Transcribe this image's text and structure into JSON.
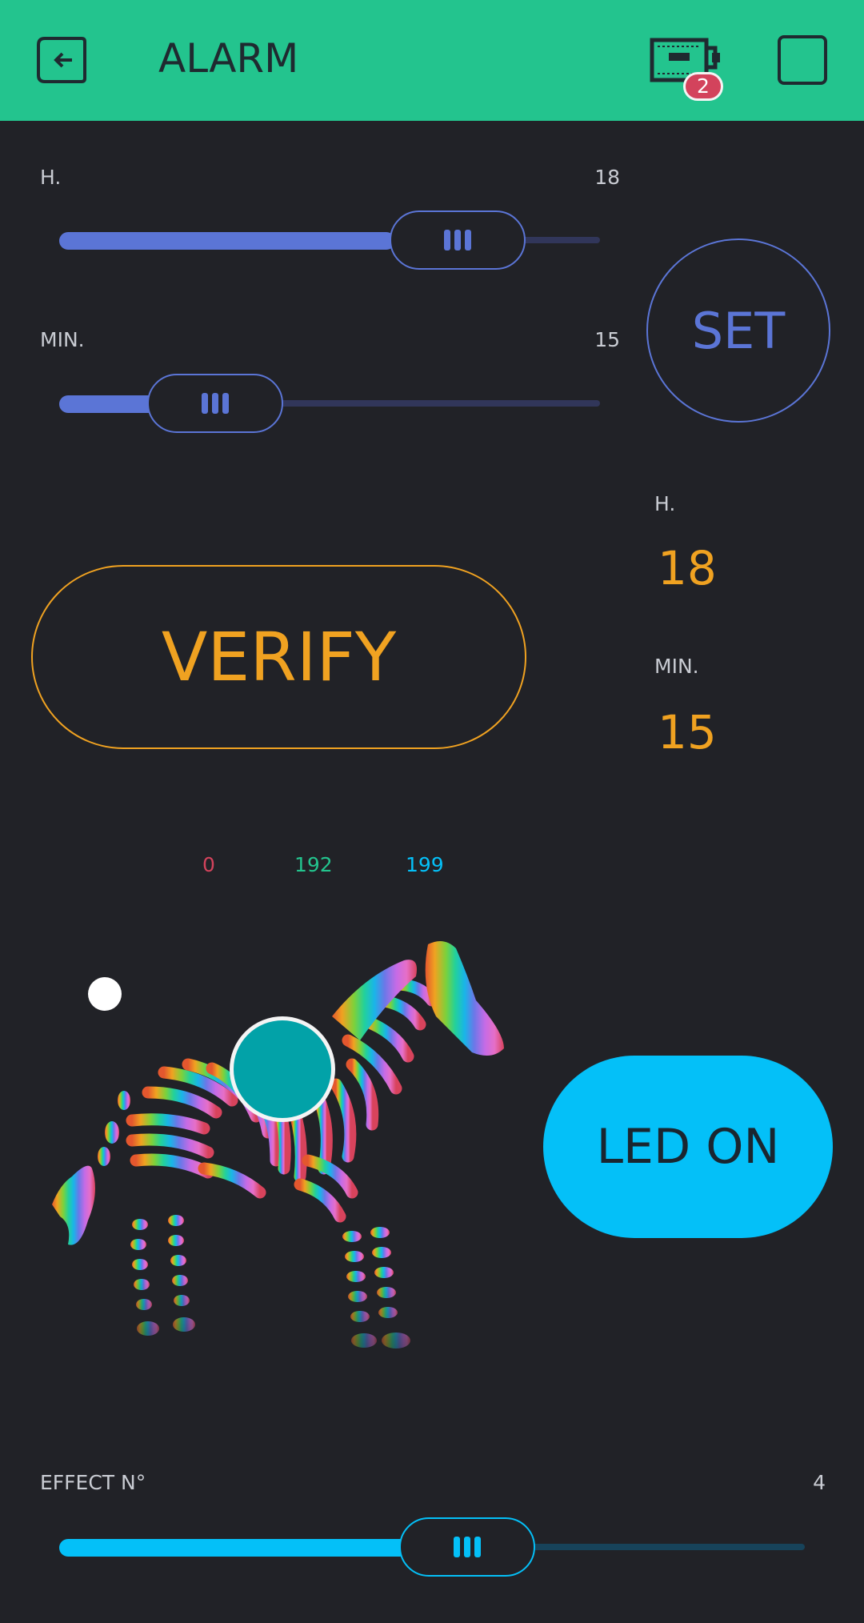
{
  "header": {
    "title": "ALARM",
    "device_badge": "2"
  },
  "colors": {
    "header_bg": "#23c48e",
    "background": "#212227",
    "slider_blue": "#5b75d6",
    "orange": "#f0a221",
    "cyan": "#04c0f8",
    "badge_red": "#d3435c"
  },
  "hour_slider": {
    "label": "H.",
    "value": "18",
    "fraction": 0.73
  },
  "minute_slider": {
    "label": "MIN.",
    "value": "15",
    "fraction": 0.29
  },
  "set_button": {
    "label": "SET"
  },
  "verify_button": {
    "label": "VERIFY"
  },
  "display": {
    "hour_label": "H.",
    "hour_value": "18",
    "minute_label": "MIN.",
    "minute_value": "15"
  },
  "zergba": {
    "r": "0",
    "g": "192",
    "b": "199",
    "r_color": "#d3435c",
    "g_color": "#23c48e",
    "b_color": "#04c0f8",
    "icon": "rainbow-zebra-icon"
  },
  "led_button": {
    "label": "LED ON"
  },
  "effect_slider": {
    "label": "EFFECT N°",
    "value": "4",
    "fraction": 0.55
  }
}
